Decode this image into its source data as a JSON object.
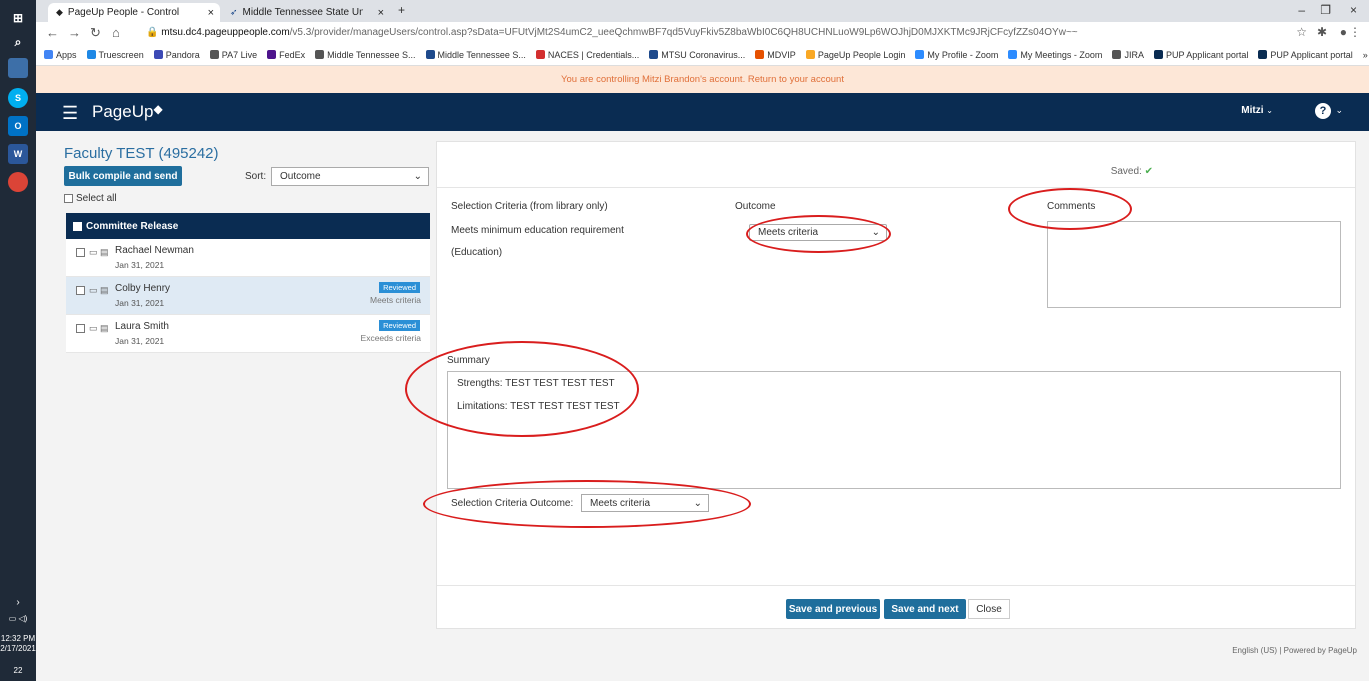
{
  "browser": {
    "tabs": [
      {
        "title": "PageUp People - Control"
      },
      {
        "title": "Middle Tennessee State Universit"
      }
    ],
    "url_host": "mtsu.dc4.pageuppeople.com",
    "url_path": "/v5.3/provider/manageUsers/control.asp?sData=UFUtVjMt2S4umC2_ueeQchmwBF7qd5VuyFkiv5Z8baWbI0C6QH8UCHNLuoW9Lp6WOJhjD0MJXKTMc9JRjCFcyfZZs04OYw~~",
    "bookmarks": [
      {
        "label": "Apps",
        "color": "#4285f4"
      },
      {
        "label": "Truescreen",
        "color": "#1e88e5"
      },
      {
        "label": "Pandora",
        "color": "#3c4ab5"
      },
      {
        "label": "PA7 Live",
        "color": "#555555"
      },
      {
        "label": "FedEx",
        "color": "#4d148c"
      },
      {
        "label": "Middle Tennessee S...",
        "color": "#555555"
      },
      {
        "label": "Middle Tennessee S...",
        "color": "#1e4a8c"
      },
      {
        "label": "NACES | Credentials...",
        "color": "#d32f2f"
      },
      {
        "label": "MTSU Coronavirus...",
        "color": "#1e4a8c"
      },
      {
        "label": "MDVIP",
        "color": "#e65100"
      },
      {
        "label": "PageUp People Login",
        "color": "#f9a825"
      },
      {
        "label": "My Profile - Zoom",
        "color": "#2d8cff"
      },
      {
        "label": "My Meetings - Zoom",
        "color": "#2d8cff"
      },
      {
        "label": "JIRA",
        "color": "#555555"
      },
      {
        "label": "PUP Applicant portal",
        "color": "#0a2c52"
      },
      {
        "label": "PUP Applicant portal",
        "color": "#0a2c52"
      }
    ],
    "bookmarks_more": "»"
  },
  "taskbar": {
    "time": "12:32 PM",
    "date": "2/17/2021",
    "notifications": "22"
  },
  "banner": {
    "text": "You are controlling Mitzi Brandon's account. Return to your account"
  },
  "nav": {
    "logo": "PageUp",
    "user": "Mitzi",
    "help": "?"
  },
  "left": {
    "title": "Faculty TEST (495242)",
    "bulk_button": "Bulk compile and send",
    "sort_label": "Sort:",
    "sort_value": "Outcome",
    "select_all": "Select all",
    "group_header": "Committee Release",
    "applicants": [
      {
        "name": "Rachael Newman",
        "date": "Jan 31, 2021",
        "badge": "",
        "outcome": ""
      },
      {
        "name": "Colby Henry",
        "date": "Jan 31, 2021",
        "badge": "Reviewed",
        "outcome": "Meets criteria"
      },
      {
        "name": "Laura Smith",
        "date": "Jan 31, 2021",
        "badge": "Reviewed",
        "outcome": "Exceeds criteria"
      }
    ]
  },
  "panel": {
    "saved_label": "Saved:",
    "criteria_header": "Selection Criteria (from library only)",
    "outcome_header": "Outcome",
    "comments_header": "Comments",
    "criterion_text": "Meets minimum education requirement",
    "criterion_sub": "(Education)",
    "outcome_value": "Meets criteria",
    "summary_label": "Summary",
    "strengths": "Strengths:  TEST TEST TEST TEST",
    "limitations": "Limitations: TEST TEST TEST TEST",
    "sco_label": "Selection Criteria Outcome:",
    "sco_value": "Meets criteria",
    "save_previous": "Save and previous",
    "save_next": "Save and next",
    "close": "Close"
  },
  "footer": {
    "text": "English (US) | Powered by PageUp"
  },
  "colors": {
    "nav_bg": "#0a2c52",
    "primary_button": "#1f6e9c",
    "banner_bg": "#fde7d7",
    "banner_text": "#e0703a",
    "title": "#2a6ea1",
    "annotation": "#d91d1d"
  }
}
